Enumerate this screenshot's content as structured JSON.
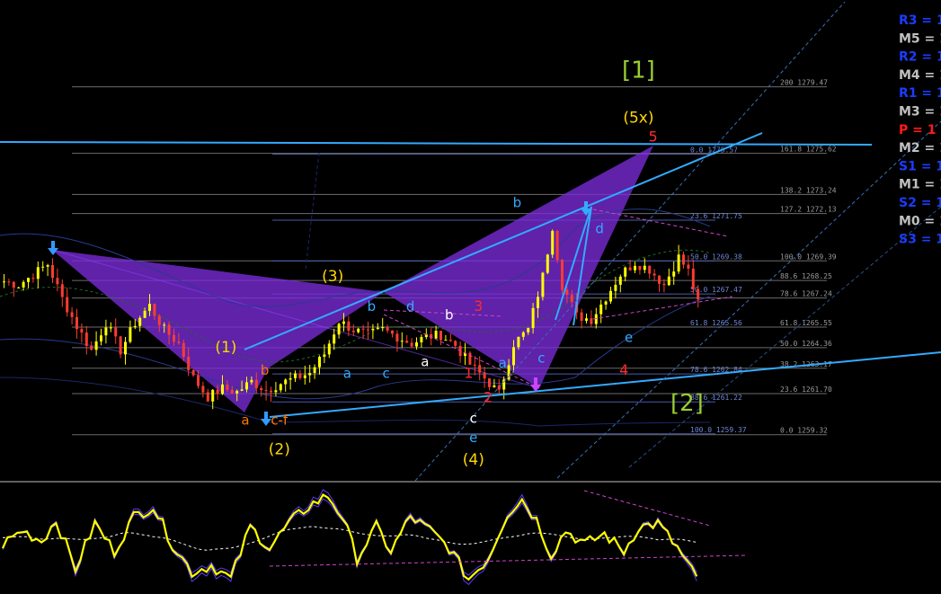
{
  "chart_data": [
    {
      "type": "candlestick",
      "title": "",
      "ylim": [
        1256.6,
        1284.5
      ],
      "colors": {
        "background": "#000000",
        "bull_candle": "#ffff00",
        "bear_candle": "#ff3b30",
        "harmonic_fill": "#7a2bd8",
        "trendline": "#33aaff",
        "fib_line": "#6b6b6b",
        "fib_text": "#9a9a9a",
        "wave_major": "#9acd32",
        "wave_intermediate": "#ffd700",
        "wave_minor_red": "#ff2a2a",
        "wave_minor_orange": "#ff7700",
        "wave_abc_blue": "#33aaff",
        "wave_abc_white": "#ffffff"
      },
      "price_path": [
        {
          "i": 0,
          "c": 1268.2
        },
        {
          "i": 3,
          "c": 1268.0
        },
        {
          "i": 6,
          "c": 1268.6
        },
        {
          "i": 9,
          "c": 1269.2
        },
        {
          "i": 12,
          "c": 1267.2
        },
        {
          "i": 15,
          "c": 1265.6
        },
        {
          "i": 18,
          "c": 1264.2
        },
        {
          "i": 21,
          "c": 1265.8
        },
        {
          "i": 24,
          "c": 1264.2
        },
        {
          "i": 27,
          "c": 1265.8
        },
        {
          "i": 30,
          "c": 1266.8
        },
        {
          "i": 33,
          "c": 1265.4
        },
        {
          "i": 36,
          "c": 1264.6
        },
        {
          "i": 39,
          "c": 1262.6
        },
        {
          "i": 42,
          "c": 1261.5
        },
        {
          "i": 45,
          "c": 1262.0
        },
        {
          "i": 48,
          "c": 1261.8
        },
        {
          "i": 51,
          "c": 1262.4
        },
        {
          "i": 54,
          "c": 1261.9
        },
        {
          "i": 57,
          "c": 1262.3
        },
        {
          "i": 60,
          "c": 1262.6
        },
        {
          "i": 63,
          "c": 1262.9
        },
        {
          "i": 66,
          "c": 1264.0
        },
        {
          "i": 69,
          "c": 1265.9
        },
        {
          "i": 72,
          "c": 1265.4
        },
        {
          "i": 75,
          "c": 1265.1
        },
        {
          "i": 78,
          "c": 1265.4
        },
        {
          "i": 81,
          "c": 1265.0
        },
        {
          "i": 84,
          "c": 1264.6
        },
        {
          "i": 87,
          "c": 1265.0
        },
        {
          "i": 90,
          "c": 1265.1
        },
        {
          "i": 93,
          "c": 1264.5
        },
        {
          "i": 96,
          "c": 1263.4
        },
        {
          "i": 99,
          "c": 1262.6
        },
        {
          "i": 102,
          "c": 1261.7
        },
        {
          "i": 105,
          "c": 1264.6
        },
        {
          "i": 108,
          "c": 1265.4
        },
        {
          "i": 111,
          "c": 1268.5
        },
        {
          "i": 113,
          "c": 1271.4
        },
        {
          "i": 115,
          "c": 1268.0
        },
        {
          "i": 118,
          "c": 1266.2
        },
        {
          "i": 121,
          "c": 1266.0
        },
        {
          "i": 124,
          "c": 1267.3
        },
        {
          "i": 127,
          "c": 1268.6
        },
        {
          "i": 130,
          "c": 1269.3
        },
        {
          "i": 133,
          "c": 1268.9
        },
        {
          "i": 136,
          "c": 1268.0
        },
        {
          "i": 139,
          "c": 1269.6
        },
        {
          "i": 141,
          "c": 1268.8
        },
        {
          "i": 143,
          "c": 1266.9
        }
      ],
      "fib_levels": [
        {
          "text": "200 1279.47",
          "price": 1279.47,
          "x_start": 0,
          "style": "dim"
        },
        {
          "text": "0.0 1275.57",
          "price": 1275.57,
          "x_start": 54,
          "style": "accent"
        },
        {
          "text": "161.8 1275.62",
          "price": 1275.62,
          "x_start": 107,
          "style": "dim"
        },
        {
          "text": "138.2 1273.24",
          "price": 1273.24,
          "x_start": 0,
          "style": "dim"
        },
        {
          "text": "127.2 1272.13",
          "price": 1272.13,
          "x_start": 0,
          "style": "dim"
        },
        {
          "text": "23.6 1271.75",
          "price": 1271.75,
          "x_start": 54,
          "style": "accent"
        },
        {
          "text": "100.0 1269.39",
          "price": 1269.39,
          "x_start": 0,
          "style": "dim"
        },
        {
          "text": "50.0 1269.38",
          "price": 1269.38,
          "x_start": 54,
          "style": "accent"
        },
        {
          "text": "88.6 1268.25",
          "price": 1268.25,
          "x_start": 0,
          "style": "dim"
        },
        {
          "text": "50.0 1267.47",
          "price": 1267.47,
          "x_start": 54,
          "style": "accent"
        },
        {
          "text": "78.6 1267.24",
          "price": 1267.24,
          "x_start": 0,
          "style": "dim"
        },
        {
          "text": "61.8 1265.56",
          "price": 1265.56,
          "x_start": 54,
          "style": "accent"
        },
        {
          "text": "61.8 1265.55",
          "price": 1265.55,
          "x_start": 0,
          "style": "dim"
        },
        {
          "text": "50.0 1264.36",
          "price": 1264.36,
          "x_start": 0,
          "style": "dim"
        },
        {
          "text": "38.2 1263.17",
          "price": 1263.17,
          "x_start": 0,
          "style": "dim"
        },
        {
          "text": "78.6 1262.84",
          "price": 1262.84,
          "x_start": 54,
          "style": "accent"
        },
        {
          "text": "23.6 1261.70",
          "price": 1261.7,
          "x_start": 0,
          "style": "dim"
        },
        {
          "text": "88.6 1261.22",
          "price": 1261.22,
          "x_start": 54,
          "style": "accent"
        },
        {
          "text": "100.0 1259.37",
          "price": 1259.37,
          "x_start": 54,
          "style": "accent"
        },
        {
          "text": "0.0 1259.32",
          "price": 1259.32,
          "x_start": 0,
          "style": "dim"
        }
      ],
      "pivots": [
        {
          "label": "R3 = 1",
          "color": "#1a3cff"
        },
        {
          "label": "M5 = 1",
          "color": "#c0c0c0"
        },
        {
          "label": "R2 = 1",
          "color": "#1a3cff"
        },
        {
          "label": "M4 = 1",
          "color": "#c0c0c0"
        },
        {
          "label": "R1 = 1",
          "color": "#1a3cff"
        },
        {
          "label": "M3 = 1",
          "color": "#c0c0c0"
        },
        {
          "label": "P   = 1",
          "color": "#ff1a1a"
        },
        {
          "label": "M2 = 1",
          "color": "#c0c0c0"
        },
        {
          "label": "S1 = 1",
          "color": "#1a3cff"
        },
        {
          "label": "M1 = 1",
          "color": "#c0c0c0"
        },
        {
          "label": "S2 = 1",
          "color": "#1a3cff"
        },
        {
          "label": "M0 = 1",
          "color": "#c0c0c0"
        },
        {
          "label": "S3 = 1",
          "color": "#1a3cff"
        }
      ],
      "wave_labels": [
        {
          "text": "[1]",
          "i": 131,
          "price": 1280.0,
          "size": 26,
          "group": "major"
        },
        {
          "text": "[2]",
          "i": 141,
          "price": 1260.7,
          "size": 26,
          "group": "major"
        },
        {
          "text": "(5x)",
          "i": 131,
          "price": 1277.4,
          "size": 17,
          "group": "intermediate"
        },
        {
          "text": "(1)",
          "i": 46,
          "price": 1264.1,
          "size": 17,
          "group": "intermediate"
        },
        {
          "text": "(2)",
          "i": 57,
          "price": 1258.2,
          "size": 17,
          "group": "intermediate"
        },
        {
          "text": "(3)",
          "i": 68,
          "price": 1268.2,
          "size": 17,
          "group": "intermediate"
        },
        {
          "text": "(4)",
          "i": 97,
          "price": 1257.6,
          "size": 17,
          "group": "intermediate"
        },
        {
          "text": "5",
          "i": 134,
          "price": 1276.3,
          "size": 16,
          "group": "minor_red"
        },
        {
          "text": "3",
          "i": 98,
          "price": 1266.5,
          "size": 16,
          "group": "minor_red"
        },
        {
          "text": "1",
          "i": 96,
          "price": 1262.6,
          "size": 16,
          "group": "minor_red"
        },
        {
          "text": "2",
          "i": 100,
          "price": 1261.2,
          "size": 16,
          "group": "minor_red"
        },
        {
          "text": "4",
          "i": 128,
          "price": 1262.8,
          "size": 16,
          "group": "minor_red"
        },
        {
          "text": "b",
          "i": 54,
          "price": 1262.8,
          "size": 15,
          "group": "minor_orange"
        },
        {
          "text": "a",
          "i": 50,
          "price": 1259.9,
          "size": 15,
          "group": "minor_orange"
        },
        {
          "text": "c-f",
          "i": 57,
          "price": 1259.9,
          "size": 15,
          "group": "minor_orange"
        },
        {
          "text": "b",
          "i": 76,
          "price": 1266.5,
          "size": 15,
          "group": "abc_blue"
        },
        {
          "text": "a",
          "i": 71,
          "price": 1262.6,
          "size": 15,
          "group": "abc_blue"
        },
        {
          "text": "c",
          "i": 79,
          "price": 1262.6,
          "size": 15,
          "group": "abc_blue"
        },
        {
          "text": "d",
          "i": 84,
          "price": 1266.5,
          "size": 15,
          "group": "abc_blue"
        },
        {
          "text": "b",
          "i": 106,
          "price": 1272.5,
          "size": 15,
          "group": "abc_blue"
        },
        {
          "text": "d",
          "i": 123,
          "price": 1271.0,
          "size": 15,
          "group": "abc_blue"
        },
        {
          "text": "a",
          "i": 103,
          "price": 1263.2,
          "size": 15,
          "group": "abc_blue"
        },
        {
          "text": "c",
          "i": 111,
          "price": 1263.5,
          "size": 15,
          "group": "abc_blue"
        },
        {
          "text": "e",
          "i": 129,
          "price": 1264.7,
          "size": 15,
          "group": "abc_blue"
        },
        {
          "text": "e",
          "i": 97,
          "price": 1258.9,
          "size": 15,
          "group": "abc_blue"
        },
        {
          "text": "b",
          "i": 92,
          "price": 1266.0,
          "size": 15,
          "group": "abc_white"
        },
        {
          "text": "a",
          "i": 87,
          "price": 1263.3,
          "size": 15,
          "group": "abc_white"
        },
        {
          "text": "c",
          "i": 97,
          "price": 1260.0,
          "size": 15,
          "group": "abc_white"
        }
      ]
    },
    {
      "type": "line",
      "title": "",
      "ylim": [
        -1.5,
        1.5
      ],
      "series_colors": [
        "#ffff00",
        "#5a3cff",
        "#ffffff",
        "#cc44cc"
      ],
      "oscillator_path": [
        {
          "i": 0,
          "v": -0.2
        },
        {
          "i": 4,
          "v": 0.2
        },
        {
          "i": 8,
          "v": -0.1
        },
        {
          "i": 11,
          "v": 0.5
        },
        {
          "i": 15,
          "v": -0.9
        },
        {
          "i": 19,
          "v": 0.4
        },
        {
          "i": 23,
          "v": -0.4
        },
        {
          "i": 27,
          "v": 0.6
        },
        {
          "i": 31,
          "v": 0.9
        },
        {
          "i": 35,
          "v": -0.2
        },
        {
          "i": 39,
          "v": -1.0
        },
        {
          "i": 43,
          "v": -0.8
        },
        {
          "i": 47,
          "v": -1.2
        },
        {
          "i": 51,
          "v": 0.3
        },
        {
          "i": 55,
          "v": -0.3
        },
        {
          "i": 59,
          "v": 0.4
        },
        {
          "i": 63,
          "v": 0.9
        },
        {
          "i": 67,
          "v": 1.2
        },
        {
          "i": 70,
          "v": 0.6
        },
        {
          "i": 73,
          "v": -0.6
        },
        {
          "i": 77,
          "v": 0.3
        },
        {
          "i": 80,
          "v": -0.4
        },
        {
          "i": 84,
          "v": 0.6
        },
        {
          "i": 88,
          "v": 0.2
        },
        {
          "i": 92,
          "v": -0.3
        },
        {
          "i": 96,
          "v": -1.2
        },
        {
          "i": 100,
          "v": -0.6
        },
        {
          "i": 104,
          "v": 0.7
        },
        {
          "i": 107,
          "v": 1.1
        },
        {
          "i": 110,
          "v": 0.5
        },
        {
          "i": 113,
          "v": -0.5
        },
        {
          "i": 116,
          "v": 0.2
        },
        {
          "i": 120,
          "v": -0.2
        },
        {
          "i": 124,
          "v": 0.1
        },
        {
          "i": 128,
          "v": -0.4
        },
        {
          "i": 131,
          "v": 0.3
        },
        {
          "i": 135,
          "v": 0.4
        },
        {
          "i": 139,
          "v": -0.3
        },
        {
          "i": 143,
          "v": -1.2
        }
      ]
    }
  ]
}
